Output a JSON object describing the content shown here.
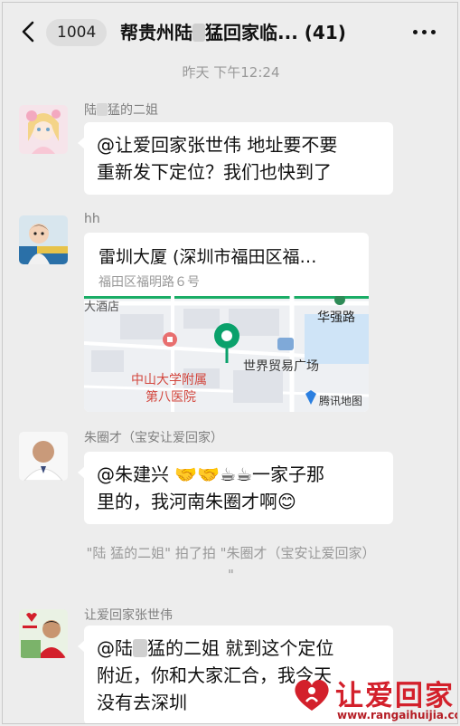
{
  "header": {
    "badge_count": "1004",
    "title_prefix": "帮贵州陆",
    "title_suffix": "猛回家临...",
    "member_count": "(41)"
  },
  "timestamp": "昨天 下午12:24",
  "messages": [
    {
      "sender_prefix": "陆",
      "sender_suffix": "猛的二姐",
      "line1": "@让爱回家张世伟 地址要不要",
      "line2": "重新发下定位？我们也快到了"
    },
    {
      "sender": "hh",
      "location_title": "雷圳大厦 (深圳市福田区福…",
      "location_address": "福田区福明路６号",
      "map_labels": {
        "hotel": "大酒店",
        "road": "华强路",
        "trade": "世界贸易广场",
        "hospital_line1": "中山大学附属",
        "hospital_line2": "第八医院",
        "provider": "腾讯地图"
      }
    },
    {
      "sender": "朱圈才（宝安让爱回家）",
      "line1": "@朱建兴 🤝🤝☕☕一家子那",
      "line2": "里的，我河南朱圈才啊😊"
    },
    {
      "sender": "让爱回家张世伟",
      "line1_prefix": "@陆",
      "line1_suffix": "猛的二姐 就到这个定位",
      "line2": "附近，你和大家汇合，我今天",
      "line3": "没有去深圳"
    }
  ],
  "system_message": {
    "line1": "\"陆  猛的二姐\" 拍了拍 \"朱圈才（宝安让爱回家）",
    "line2": "\""
  },
  "watermark": {
    "text": "让爱回家",
    "url": "www.rangaihuijia.com"
  },
  "colors": {
    "background": "#ededed",
    "bubble": "#ffffff",
    "watermark_red": "#d3202b",
    "map_pin_green": "#07c160"
  }
}
